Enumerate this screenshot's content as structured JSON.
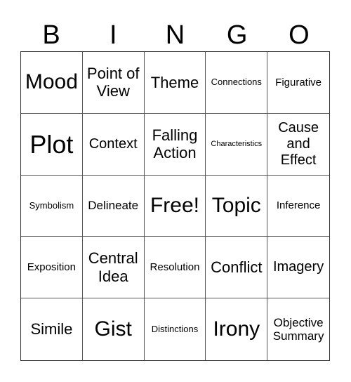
{
  "header": [
    "B",
    "I",
    "N",
    "G",
    "O"
  ],
  "cells": [
    {
      "text": "Mood",
      "size": "s-l"
    },
    {
      "text": "Point of View",
      "size": "s-m"
    },
    {
      "text": "Theme",
      "size": "s-m"
    },
    {
      "text": "Connections",
      "size": "s-xxs"
    },
    {
      "text": "Figurative",
      "size": "s-xs"
    },
    {
      "text": "Plot",
      "size": "s-xl"
    },
    {
      "text": "Context",
      "size": "s-ms"
    },
    {
      "text": "Falling Action",
      "size": "s-m"
    },
    {
      "text": "Characteristics",
      "size": "s-tiny"
    },
    {
      "text": "Cause and Effect",
      "size": "s-ms"
    },
    {
      "text": "Symbolism",
      "size": "s-xxs"
    },
    {
      "text": "Delineate",
      "size": "s-s"
    },
    {
      "text": "Free!",
      "size": "s-l"
    },
    {
      "text": "Topic",
      "size": "s-l"
    },
    {
      "text": "Inference",
      "size": "s-xs"
    },
    {
      "text": "Exposition",
      "size": "s-xs"
    },
    {
      "text": "Central Idea",
      "size": "s-m"
    },
    {
      "text": "Resolution",
      "size": "s-xs"
    },
    {
      "text": "Conflict",
      "size": "s-m"
    },
    {
      "text": "Imagery",
      "size": "s-ms"
    },
    {
      "text": "Simile",
      "size": "s-m"
    },
    {
      "text": "Gist",
      "size": "s-l"
    },
    {
      "text": "Distinctions",
      "size": "s-xxs"
    },
    {
      "text": "Irony",
      "size": "s-l"
    },
    {
      "text": "Objective Summary",
      "size": "s-s"
    }
  ]
}
